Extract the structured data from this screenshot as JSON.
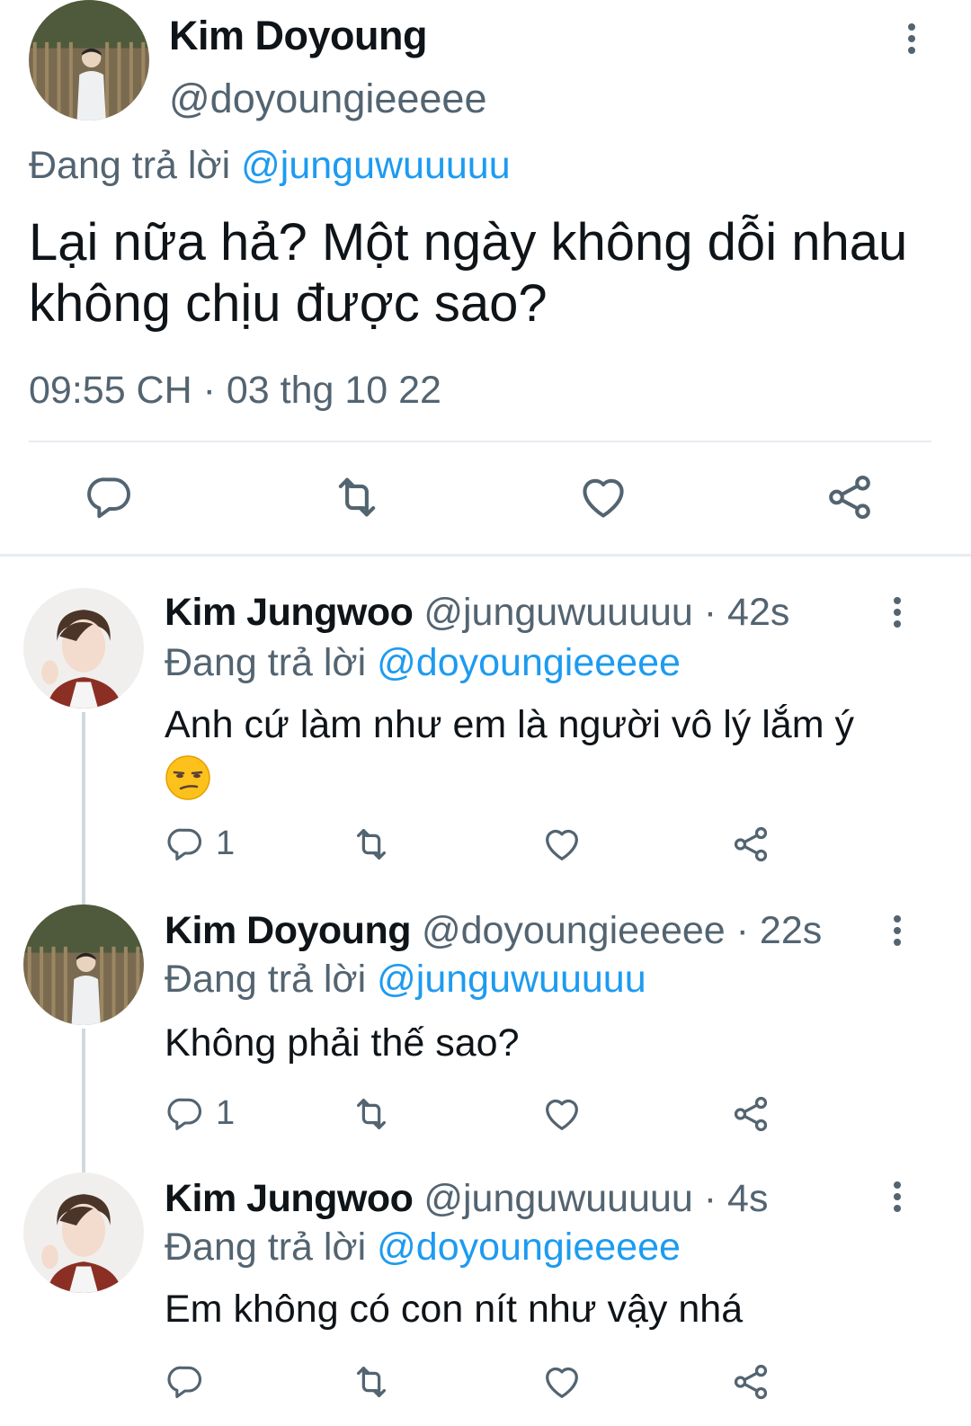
{
  "main": {
    "name": "Kim Doyoung",
    "handle": "@doyoungieeeee",
    "replying_prefix": "Đang trả lời",
    "replying_to": "@junguwuuuuu",
    "text": "Lại nữa hả? Một ngày không dỗi nhau không chịu được sao?",
    "time": "09:55 CH · 03 thg 10 22"
  },
  "replies": [
    {
      "name": "Kim Jungwoo",
      "handle": "@junguwuuuuu",
      "age": "· 42s",
      "replying_prefix": "Đang trả lời",
      "replying_to": "@doyoungieeeee",
      "text": "Anh cứ làm như em là người vô lý lắm ý",
      "emoji": "unamused-face",
      "reply_count": "1"
    },
    {
      "name": "Kim Doyoung",
      "handle": "@doyoungieeeee",
      "age": "· 22s",
      "replying_prefix": "Đang trả lời",
      "replying_to": "@junguwuuuuu",
      "text": "Không phải thế sao?",
      "reply_count": "1"
    },
    {
      "name": "Kim Jungwoo",
      "handle": "@junguwuuuuu",
      "age": "· 4s",
      "replying_prefix": "Đang trả lời",
      "replying_to": "@doyoungieeeee",
      "text": "Em không có con nít như vậy nhá",
      "reply_count": ""
    }
  ],
  "icons": [
    "reply-icon",
    "retweet-icon",
    "like-icon",
    "share-icon",
    "more-icon"
  ],
  "colors": {
    "text": "#0f1419",
    "muted": "#536471",
    "accent": "#1d9bf0",
    "divider": "#e6ecf0"
  }
}
